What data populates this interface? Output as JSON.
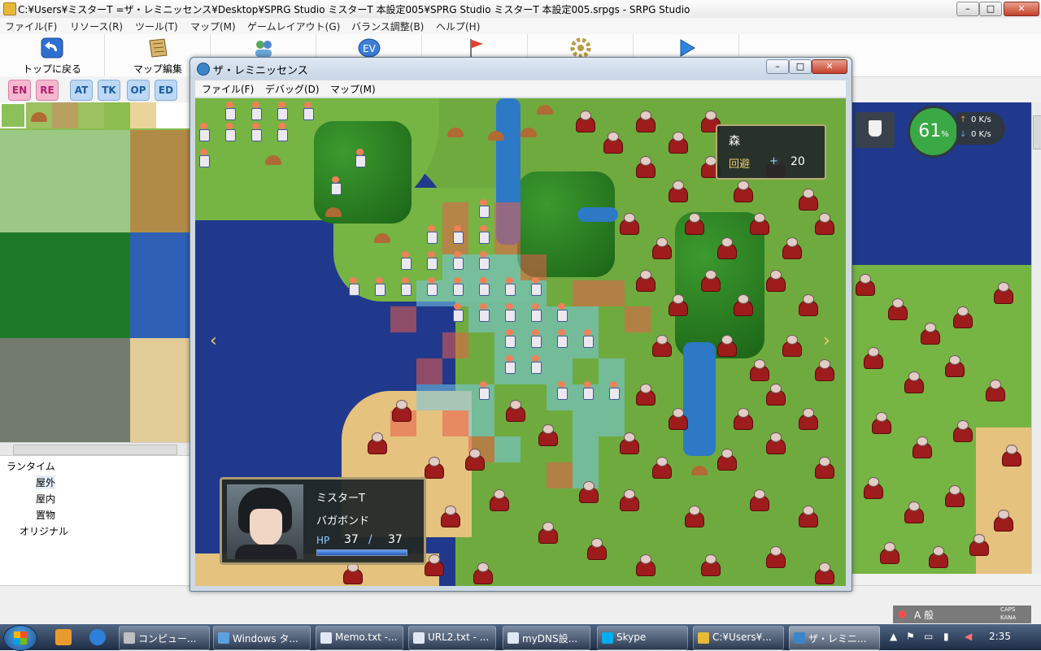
{
  "editor": {
    "title": "C:¥Users¥ミスターT =ザ・レミニッセンス¥Desktop¥SPRG Studio ミスターT 本設定005¥SPRG Studio ミスターT 本設定005.srpgs - SRPG Studio",
    "window_buttons": [
      "–",
      "□",
      "✕"
    ],
    "menu": [
      "ファイル(F)",
      "リソース(R)",
      "ツール(T)",
      "マップ(M)",
      "ゲームレイアウト(G)",
      "バランス調整(B)",
      "ヘルプ(H)"
    ],
    "toolbar": [
      {
        "label": "トップに戻る",
        "icon": "back-arrow-icon"
      },
      {
        "label": "マップ編集",
        "icon": "map-scroll-icon"
      },
      {
        "label": "",
        "icon": "units-icon"
      },
      {
        "label": "",
        "icon": "event-icon"
      },
      {
        "label": "",
        "icon": "flag-icon"
      },
      {
        "label": "",
        "icon": "gear-icon"
      },
      {
        "label": "",
        "icon": "play-icon"
      }
    ],
    "layer_buttons": [
      "EN",
      "RE",
      "AT",
      "TK",
      "OP",
      "ED"
    ],
    "tree": {
      "root": "ランタイム",
      "children": [
        "屋外",
        "屋内",
        "置物"
      ],
      "other": "オリジナル"
    }
  },
  "network_widget": {
    "percent": "61",
    "percent_unit": "%",
    "up": "0 K/s",
    "down": "0 K/s",
    "up_arrow": "↑",
    "down_arrow": "↓"
  },
  "ime": {
    "mode": "A 般",
    "caps": "CAPS",
    "kana": "KANA"
  },
  "game": {
    "title": "ザ・レミニッセンス",
    "window_buttons": [
      "–",
      "□",
      "✕"
    ],
    "menu": [
      "ファイル(F)",
      "デバッグ(D)",
      "マップ(M)"
    ],
    "terrain": {
      "name": "森",
      "stat_label": "回避",
      "plus": "+",
      "value": "20"
    },
    "unit": {
      "name": "ミスターT",
      "class": "バガボンド",
      "hp_label": "HP",
      "hp_current": "37",
      "hp_slash": "/",
      "hp_max": "37",
      "hp_fraction": 1.0
    },
    "nav_left": "‹",
    "nav_right": "›"
  },
  "taskbar": {
    "items": [
      {
        "label": "コンピュー...",
        "color": "#c0c0c0"
      },
      {
        "label": "Windows タ...",
        "color": "#5aa0e0"
      },
      {
        "label": "Memo.txt -...",
        "color": "#dfe9f5"
      },
      {
        "label": "URL2.txt - ...",
        "color": "#dfe9f5"
      },
      {
        "label": "myDNS設...",
        "color": "#dfe9f5"
      },
      {
        "label": "Skype",
        "color": "#00aff0"
      },
      {
        "label": "C:¥Users¥...",
        "color": "#e8b838"
      },
      {
        "label": "ザ・レミニ...",
        "color": "#3c84c7"
      }
    ],
    "clock": "2:35"
  }
}
